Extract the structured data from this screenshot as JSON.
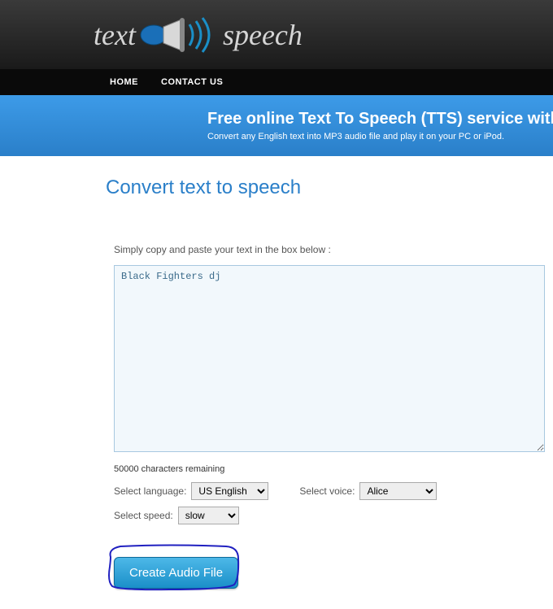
{
  "logo": {
    "text_left": "text",
    "text_right": "speech"
  },
  "nav": {
    "home": "HOME",
    "contact": "CONTACT US"
  },
  "banner": {
    "title": "Free online Text To Speech (TTS) service with natural s",
    "subtitle": "Convert any English text into MP3 audio file and play it on your PC or iPod."
  },
  "page": {
    "title": "Convert text to speech"
  },
  "form": {
    "instruction": "Simply copy and paste your text in the box below :",
    "text_value": "Black Fighters dj",
    "char_count": "50000 characters remaining",
    "language_label": "Select language:",
    "language_value": "US English",
    "voice_label": "Select voice:",
    "voice_value": "Alice",
    "speed_label": "Select speed:",
    "speed_value": "slow",
    "submit_label": "Create Audio File"
  }
}
